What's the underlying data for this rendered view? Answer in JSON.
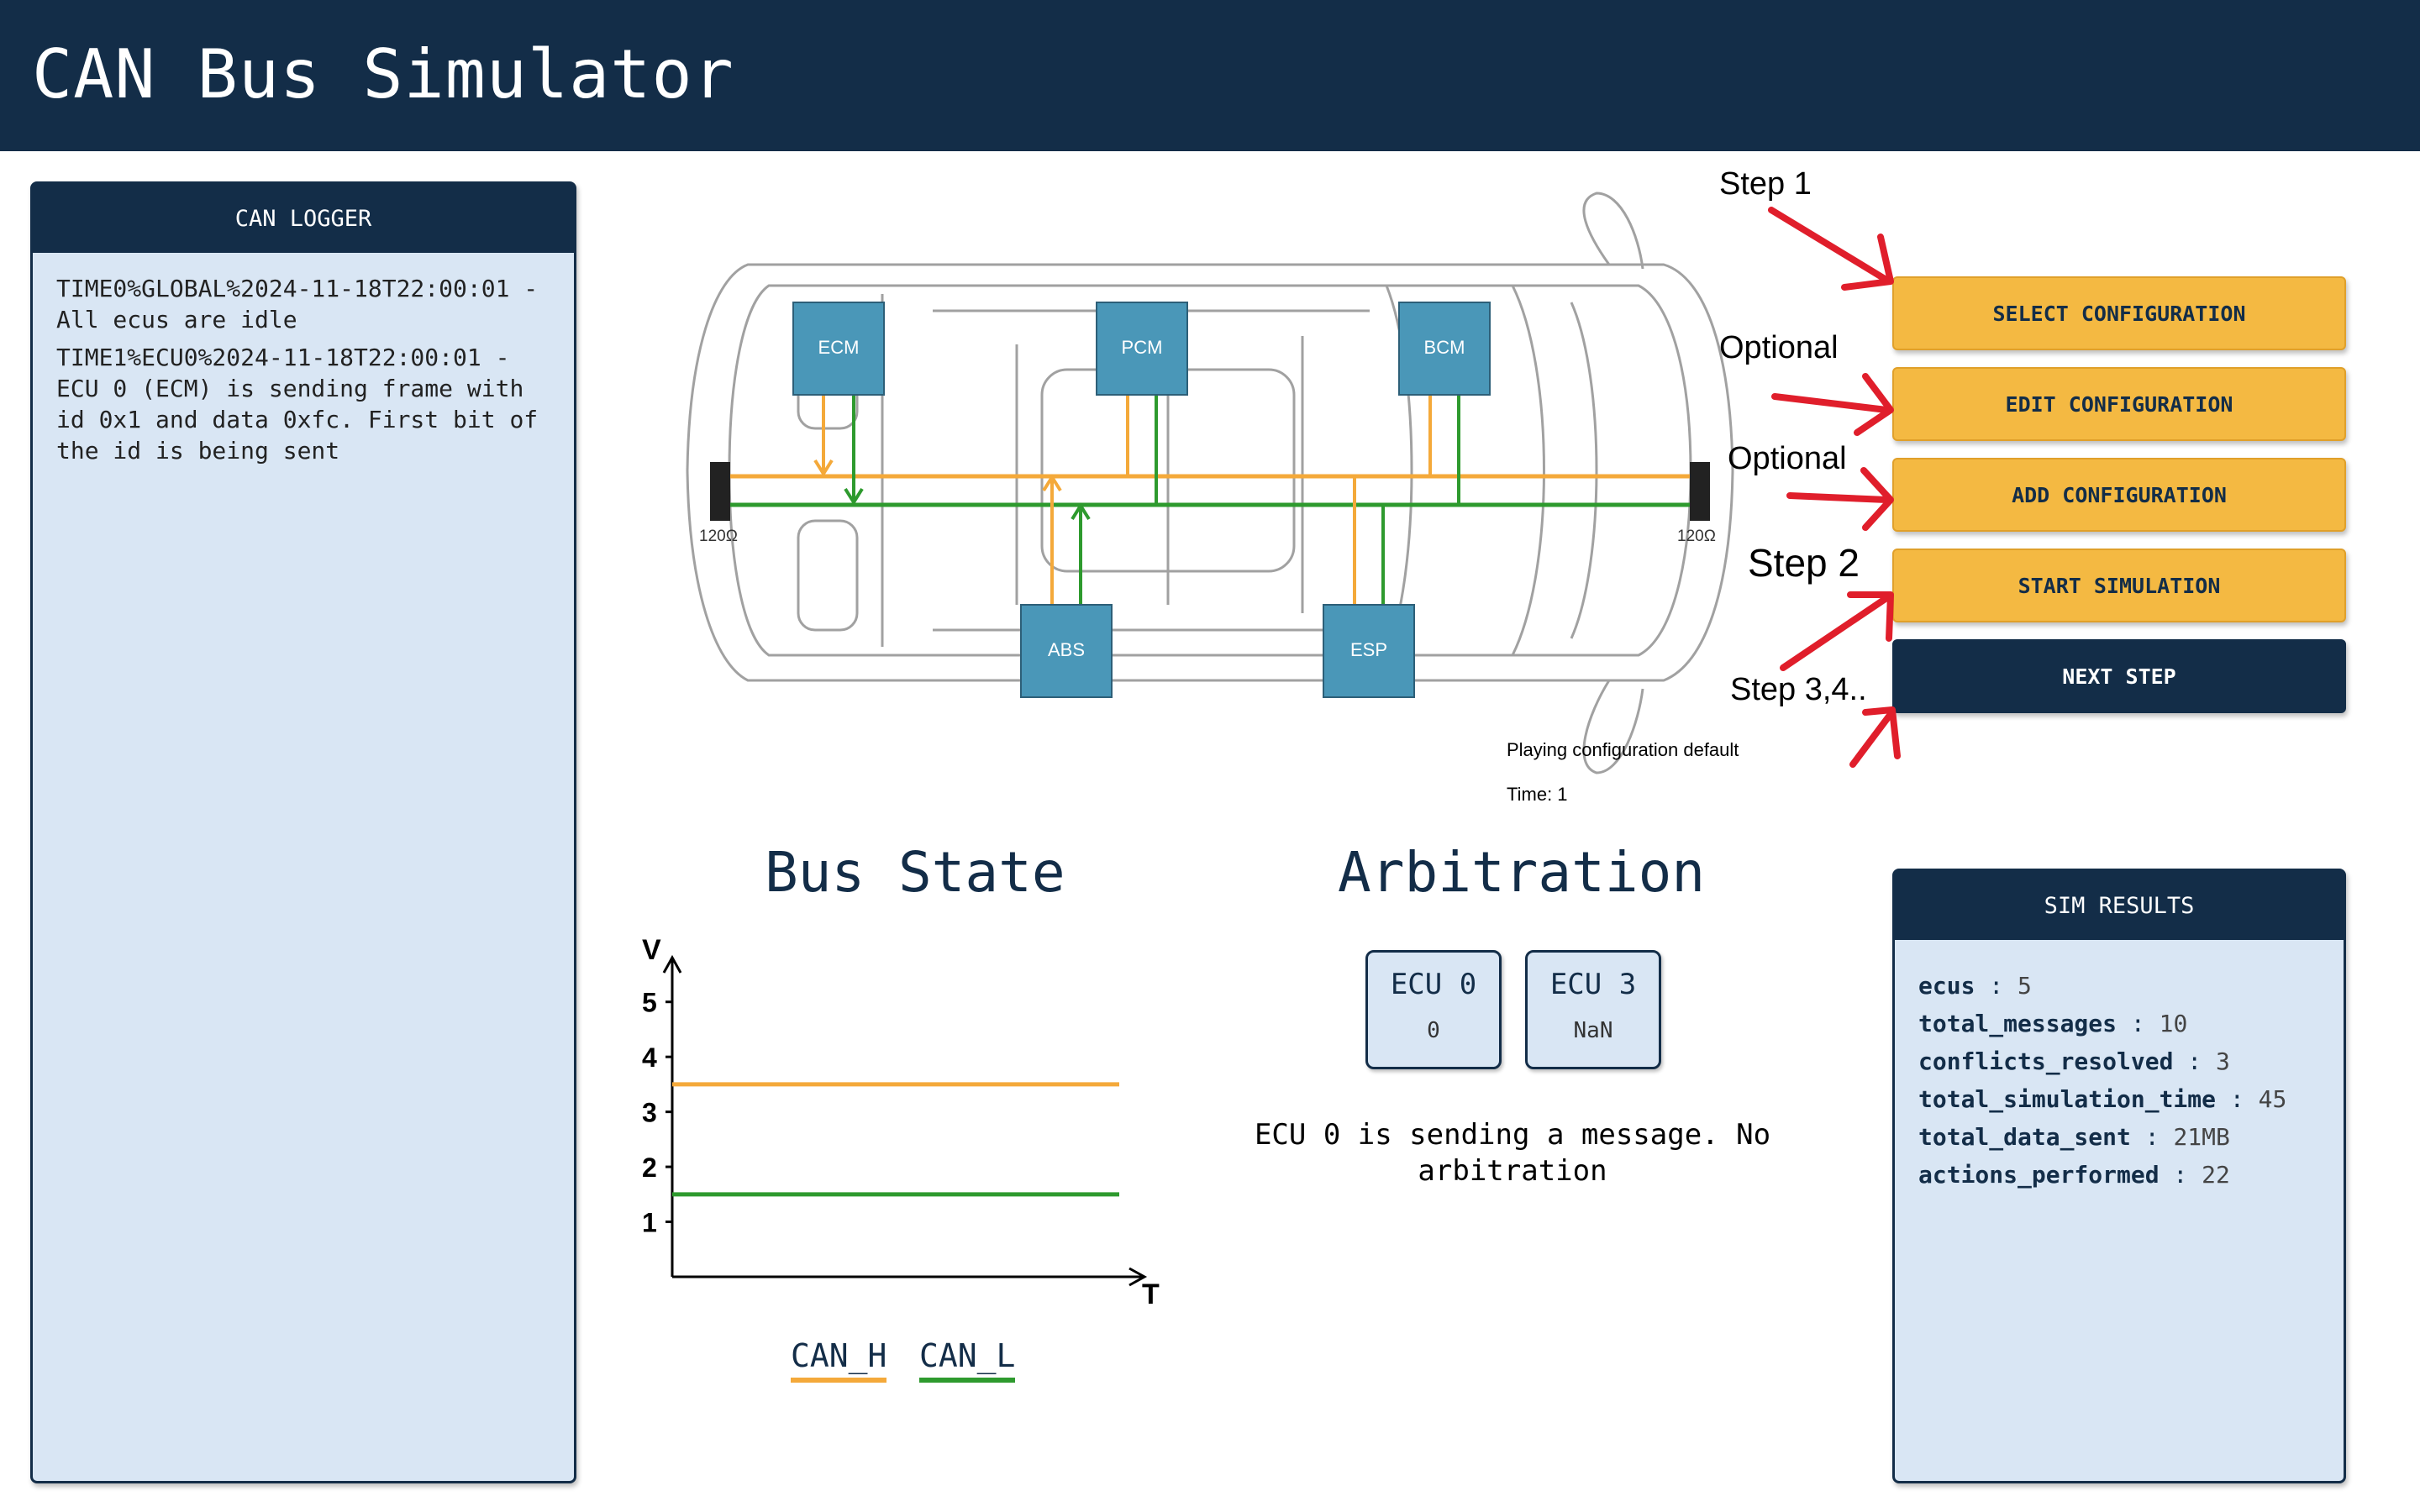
{
  "app": {
    "title": "CAN Bus Simulator"
  },
  "logger": {
    "title": "CAN LOGGER",
    "entries": [
      "TIME0%GLOBAL%2024-11-18T22:00:01 - All ecus are idle",
      "TIME1%ECU0%2024-11-18T22:00:01 - ECU 0 (ECM) is sending frame with id 0x1 and data 0xfc. First bit of the id is being sent"
    ]
  },
  "car_diagram": {
    "ecus": [
      "ECM",
      "PCM",
      "BCM",
      "ABS",
      "ESP"
    ],
    "terminator_left": "120Ω",
    "terminator_right": "120Ω",
    "status": "Playing configuration default",
    "time": "Time: 1"
  },
  "buttons": {
    "select": "SELECT CONFIGURATION",
    "edit": "EDIT CONFIGURATION",
    "add": "ADD CONFIGURATION",
    "start": "START SIMULATION",
    "next": "NEXT STEP"
  },
  "annotations": {
    "step1": "Step 1",
    "optional1": "Optional",
    "optional2": "Optional",
    "step2": "Step 2",
    "step34": "Step 3,4.."
  },
  "bus_state": {
    "title": "Bus State",
    "y_label": "V",
    "x_label": "T",
    "y_ticks": [
      "5",
      "4",
      "3",
      "2",
      "1"
    ],
    "legend_h": "CAN_H",
    "legend_l": "CAN_L",
    "colors": {
      "can_h": "#f4a93a",
      "can_l": "#2e9a2e"
    }
  },
  "chart_data": {
    "type": "line",
    "title": "Bus State",
    "xlabel": "T",
    "ylabel": "V",
    "ylim": [
      0,
      5.5
    ],
    "yticks": [
      1,
      2,
      3,
      4,
      5
    ],
    "series": [
      {
        "name": "CAN_H",
        "values": [
          3.5,
          3.5
        ]
      },
      {
        "name": "CAN_L",
        "values": [
          1.5,
          1.5
        ]
      }
    ]
  },
  "arbitration": {
    "title": "Arbitration",
    "ecus": [
      {
        "name": "ECU 0",
        "value": "0"
      },
      {
        "name": "ECU 3",
        "value": "NaN"
      }
    ],
    "message": "ECU 0 is sending a message. No arbitration"
  },
  "results": {
    "title": "SIM RESULTS",
    "rows": [
      {
        "key": "ecus",
        "value": "5"
      },
      {
        "key": "total_messages",
        "value": "10"
      },
      {
        "key": "conflicts_resolved",
        "value": "3"
      },
      {
        "key": "total_simulation_time",
        "value": "45"
      },
      {
        "key": "total_data_sent",
        "value": "21MB"
      },
      {
        "key": "actions_performed",
        "value": "22"
      }
    ]
  }
}
